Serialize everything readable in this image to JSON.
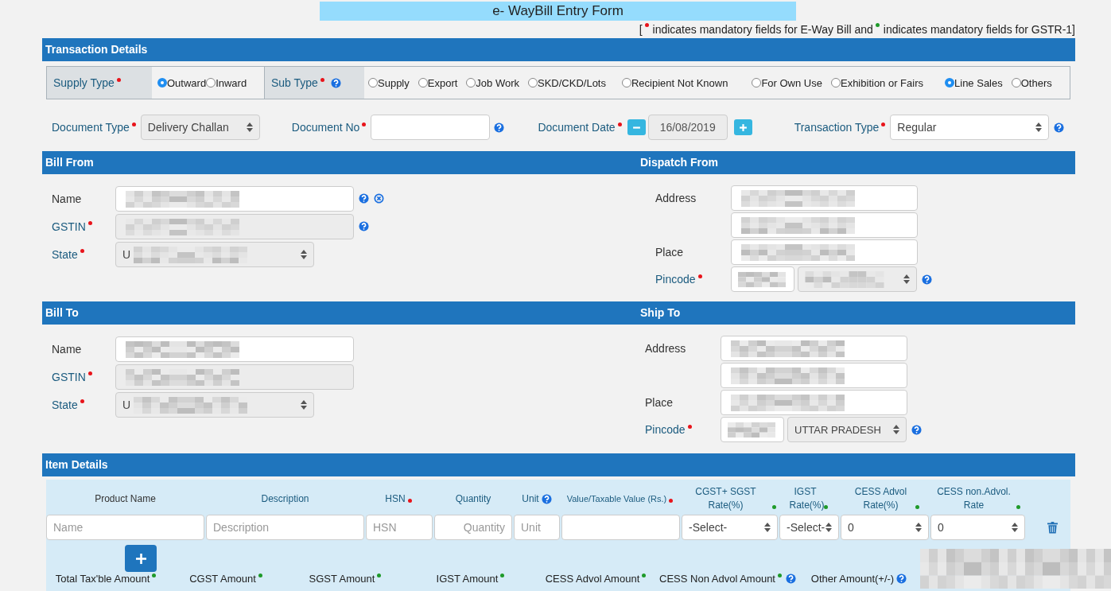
{
  "title": "e- WayBill Entry Form",
  "legend": {
    "open": "[",
    "items": [
      {
        "color": "#e8141b",
        "text": "indicates mandatory fields for E-Way Bill and"
      },
      {
        "color": "#1f9a2a",
        "text": "indicates mandatory fields for GSTR-1]"
      }
    ]
  },
  "transaction": {
    "header": "Transaction Details",
    "supply_type": {
      "label": "Supply Type",
      "color": "#e8141b",
      "options": [
        {
          "label": "Outward",
          "selected": true
        },
        {
          "label": "Inward",
          "selected": false
        }
      ]
    },
    "sub_type": {
      "label": "Sub Type",
      "color": "#e8141b",
      "help": true,
      "options": [
        {
          "label": "Supply",
          "selected": false
        },
        {
          "label": "Export",
          "selected": false
        },
        {
          "label": "Job Work",
          "selected": false
        },
        {
          "label": "SKD/CKD/Lots",
          "selected": false
        },
        {
          "label": "Recipient Not Known",
          "selected": false
        },
        {
          "label": "For Own Use",
          "selected": false
        },
        {
          "label": "Exhibition or Fairs",
          "selected": false
        },
        {
          "label": "Line Sales",
          "selected": true
        },
        {
          "label": "Others",
          "selected": false
        }
      ]
    },
    "fields": [
      {
        "kind": "select",
        "label": "Document Type",
        "color": "#e8141b",
        "value": "Delivery Challan",
        "disabled": true
      },
      {
        "kind": "input",
        "label": "Document No",
        "color": "#e8141b",
        "help": true
      },
      {
        "kind": "date",
        "label": "Document Date",
        "color": "#e8141b",
        "value": "16/08/2019",
        "disabled": true
      },
      {
        "kind": "select",
        "label": "Transaction Type",
        "color": "#e8141b",
        "value": "Regular",
        "help": true
      }
    ]
  },
  "parties": [
    {
      "left": {
        "header": "Bill From",
        "fields": [
          {
            "kind": "input",
            "label": "Name",
            "redacted": true,
            "help": true,
            "clear": true
          },
          {
            "kind": "input",
            "label": "GSTIN",
            "color": "#e8141b",
            "redacted": true,
            "disabled": true,
            "help": true
          },
          {
            "kind": "select",
            "label": "State",
            "color": "#e8141b",
            "value": "U",
            "redacted": true,
            "disabled": true
          }
        ]
      },
      "right": {
        "header": "Dispatch From",
        "fields": [
          {
            "kind": "input",
            "label": "Address",
            "redacted": true
          },
          {
            "kind": "input",
            "redacted": true
          },
          {
            "kind": "input",
            "label": "Place",
            "redacted": true
          },
          {
            "kind": "pincode",
            "label": "Pincode",
            "color": "#e8141b",
            "redacted": true,
            "help": true
          }
        ]
      }
    },
    {
      "left": {
        "header": "Bill To",
        "fields": [
          {
            "kind": "input",
            "label": "Name",
            "redacted": true
          },
          {
            "kind": "input",
            "label": "GSTIN",
            "color": "#e8141b",
            "redacted": true,
            "disabled": true
          },
          {
            "kind": "select",
            "label": "State",
            "color": "#e8141b",
            "value": "U",
            "redacted": true,
            "disabled": true
          }
        ]
      },
      "right": {
        "header": "Ship To",
        "fields": [
          {
            "kind": "input",
            "label": "Address",
            "redacted": true
          },
          {
            "kind": "input",
            "redacted": true
          },
          {
            "kind": "input",
            "label": "Place",
            "redacted": true
          },
          {
            "kind": "pincode",
            "label": "Pincode",
            "color": "#e8141b",
            "redacted": true,
            "value": "UTTAR PRADESH",
            "help": true
          }
        ]
      }
    }
  ],
  "items": {
    "header": "Item Details",
    "columns": [
      {
        "label": "Product Name",
        "kind": "input",
        "placeholder": "Name"
      },
      {
        "label": "Description",
        "kind": "input",
        "placeholder": "Description"
      },
      {
        "label": "HSN",
        "color": "#e8141b",
        "kind": "input",
        "placeholder": "HSN"
      },
      {
        "label": "Quantity",
        "kind": "input",
        "placeholder": "Quantity"
      },
      {
        "label": "Unit",
        "help": true,
        "kind": "input",
        "placeholder": "Unit"
      },
      {
        "label": "Value/Taxable Value (Rs.)",
        "color": "#e8141b",
        "kind": "input"
      },
      {
        "label": "CGST+ SGST Rate(%)",
        "color": "#1f9a2a",
        "kind": "select",
        "value": "-Select-"
      },
      {
        "label": "IGST Rate(%)",
        "color": "#1f9a2a",
        "kind": "select",
        "value": "-Select-"
      },
      {
        "label": "CESS Advol Rate(%)",
        "color": "#1f9a2a",
        "kind": "select",
        "value": "0"
      },
      {
        "label": "CESS non.Advol. Rate",
        "color": "#1f9a2a",
        "kind": "select",
        "value": "0"
      }
    ],
    "totals": [
      {
        "label": "Total Tax'ble Amount",
        "color": "#1f9a2a"
      },
      {
        "label": "CGST Amount",
        "color": "#1f9a2a"
      },
      {
        "label": "SGST Amount",
        "color": "#1f9a2a"
      },
      {
        "label": "IGST Amount",
        "color": "#1f9a2a"
      },
      {
        "label": "CESS Advol Amount",
        "color": "#1f9a2a"
      },
      {
        "label": "CESS Non Advol Amount",
        "color": "#1f9a2a",
        "help": true
      },
      {
        "label": "Other Amount(+/-)",
        "help": true
      }
    ]
  }
}
